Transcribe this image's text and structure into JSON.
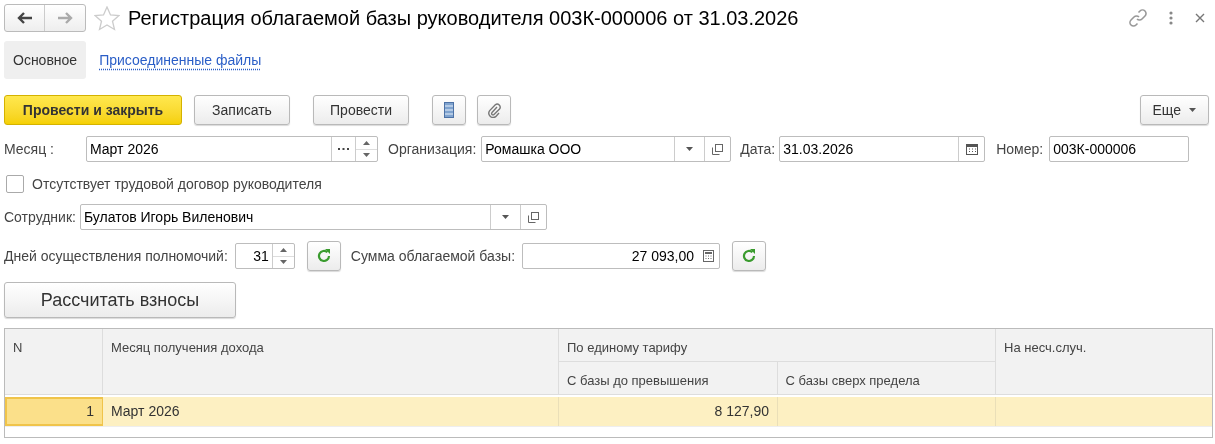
{
  "window": {
    "title": "Регистрация облагаемой базы руководителя 003К-000006 от 31.03.2026"
  },
  "tabs": [
    {
      "label": "Основное",
      "selected": true
    },
    {
      "label": "Присоединенные файлы",
      "selected": false
    }
  ],
  "toolbar": [
    {
      "kind": "primary",
      "label": "Провести и закрыть"
    },
    {
      "kind": "plain",
      "label": "Записать"
    },
    {
      "kind": "plain",
      "label": "Провести"
    },
    {
      "kind": "list-icon"
    },
    {
      "kind": "clip-icon"
    }
  ],
  "more_button": "Еще",
  "month": {
    "label": "Месяц :",
    "value": "Март 2026"
  },
  "organization": {
    "label": "Организация:",
    "value": "Ромашка ООО"
  },
  "date": {
    "label": "Дата:",
    "value": "31.03.2026"
  },
  "number": {
    "label": "Номер:",
    "value": "003К-000006"
  },
  "no_contract": {
    "label": "Отсутствует трудовой договор руководителя",
    "checked": false
  },
  "employee": {
    "label": "Сотрудник:",
    "value": "Булатов Игорь Виленович"
  },
  "days": {
    "label": "Дней осуществления полномочий:",
    "value": "31"
  },
  "base_sum": {
    "label": "Сумма облагаемой базы:",
    "value": "27 093,00"
  },
  "calc_button": "Рассчитать взносы",
  "table": {
    "columns": [
      "N",
      "Месяц получения дохода",
      "По единому тарифу",
      "На несч.случ."
    ],
    "subcolumns": [
      "С базы до превышения",
      "С базы сверх предела"
    ],
    "rows": [
      {
        "n": "1",
        "month": "Март 2026",
        "before_limit": "8 127,90",
        "selected": true
      }
    ]
  }
}
